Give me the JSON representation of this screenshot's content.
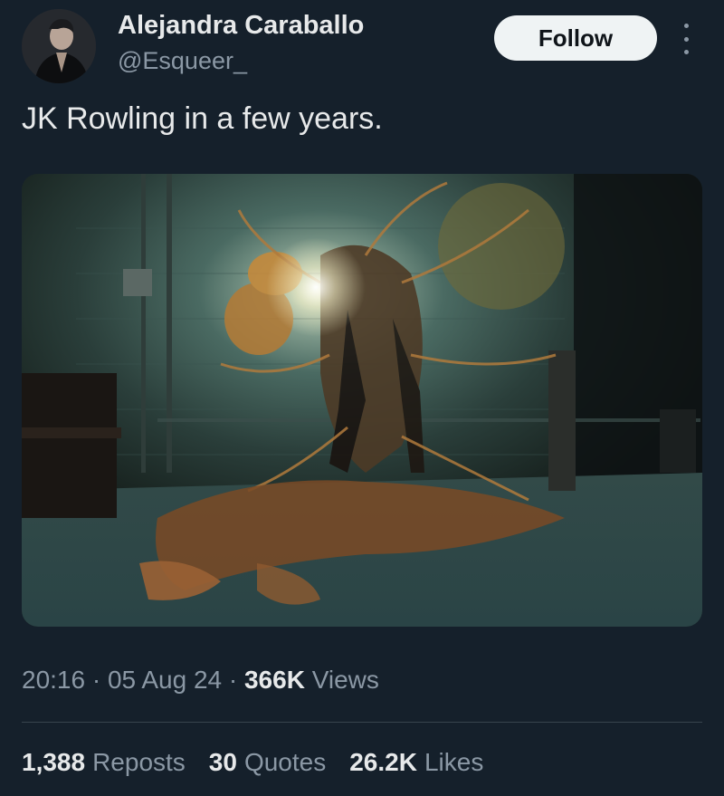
{
  "author": {
    "display_name": "Alejandra Caraballo",
    "handle": "@Esqueer_"
  },
  "actions": {
    "follow_label": "Follow",
    "more_icon": "more-vertical-icon"
  },
  "tweet": {
    "text": "JK Rowling in a few years."
  },
  "meta": {
    "time": "20:16",
    "separator1": " · ",
    "date": "05 Aug 24",
    "separator2": " · ",
    "views_count": "366K",
    "views_label": " Views"
  },
  "stats": [
    {
      "count": "1,388",
      "label": "Reposts"
    },
    {
      "count": "30",
      "label": "Quotes"
    },
    {
      "count": "26.2K",
      "label": "Likes"
    }
  ],
  "colors": {
    "background": "#15202b",
    "text_primary": "#e7e9ea",
    "text_secondary": "#8b98a5",
    "follow_bg": "#eff3f4",
    "divider": "#38444d"
  }
}
